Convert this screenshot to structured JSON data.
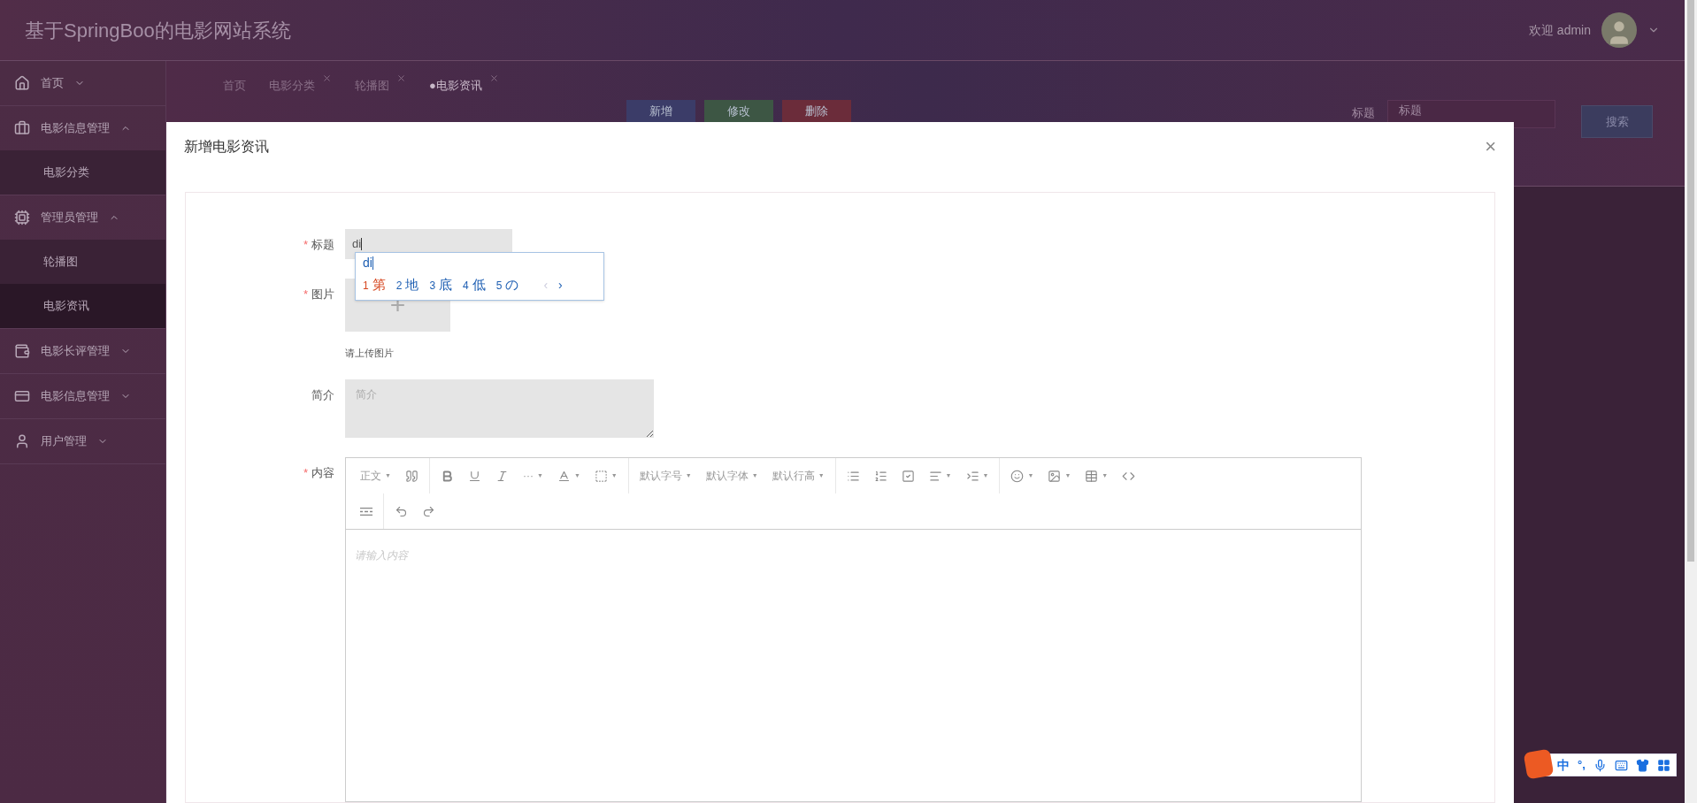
{
  "header": {
    "title": "基于SpringBoo的电影网站系统",
    "welcome": "欢迎 admin"
  },
  "sidebar": {
    "items": [
      {
        "label": "首页",
        "expanded": false,
        "selected": false
      },
      {
        "label": "电影信息管理",
        "expanded": true,
        "selected": false,
        "children": [
          {
            "label": "电影分类",
            "selected": false
          }
        ]
      },
      {
        "label": "管理员管理",
        "expanded": true,
        "selected": false,
        "children": [
          {
            "label": "轮播图",
            "selected": false
          },
          {
            "label": "电影资讯",
            "selected": true
          }
        ]
      },
      {
        "label": "电影长评管理",
        "expanded": false,
        "selected": false
      },
      {
        "label": "电影信息管理",
        "expanded": false,
        "selected": false
      },
      {
        "label": "用户管理",
        "expanded": false,
        "selected": false
      }
    ]
  },
  "tabs": [
    {
      "label": "首页",
      "selected": false,
      "closable": false
    },
    {
      "label": "电影分类",
      "selected": false,
      "closable": true
    },
    {
      "label": "轮播图",
      "selected": false,
      "closable": true
    },
    {
      "label": "●电影资讯",
      "selected": true,
      "closable": true
    }
  ],
  "actions": [
    {
      "label": "新增",
      "color": "#3b3c68"
    },
    {
      "label": "修改",
      "color": "#3d5644"
    },
    {
      "label": "删除",
      "color": "#6b2c3a"
    }
  ],
  "search": {
    "label": "标题",
    "placeholder": "标题",
    "button": "搜索"
  },
  "dialog": {
    "title": "新增电影资讯",
    "close": "×",
    "fields": [
      {
        "kind": "text",
        "label": "标题",
        "required_mark": "*",
        "value": "di",
        "ime": {
          "composition": "di",
          "candidates": [
            {
              "index": "1",
              "text": "第",
              "selected": true
            },
            {
              "index": "2",
              "text": "地",
              "selected": false
            },
            {
              "index": "3",
              "text": "底",
              "selected": false
            },
            {
              "index": "4",
              "text": "低",
              "selected": false
            },
            {
              "index": "5",
              "text": "の",
              "selected": false
            }
          ],
          "prev": "‹",
          "next": "›"
        }
      },
      {
        "kind": "upload",
        "label": "图片",
        "required_mark": "*",
        "plus": "+",
        "hint": "请上传图片"
      },
      {
        "kind": "textarea",
        "label": "简介",
        "placeholder": "简介"
      },
      {
        "kind": "editor",
        "label": "内容",
        "required_mark": "*",
        "placeholder": "请输入内容",
        "toolbar": [
          [
            {
              "kind": "text",
              "label": "正文",
              "caret": "▼"
            },
            {
              "kind": "icon"
            }
          ],
          [
            {
              "kind": "icon"
            },
            {
              "kind": "icon"
            },
            {
              "kind": "icon"
            },
            {
              "kind": "text",
              "label": "···",
              "caret": "▼"
            },
            {
              "kind": "icon",
              "caret": "▼"
            },
            {
              "kind": "icon",
              "caret": "▼"
            }
          ],
          [
            {
              "kind": "text",
              "label": "默认字号",
              "caret": "▼"
            },
            {
              "kind": "text",
              "label": "默认字体",
              "caret": "▼"
            },
            {
              "kind": "text",
              "label": "默认行高",
              "caret": "▼"
            }
          ],
          [
            {
              "kind": "icon"
            },
            {
              "kind": "icon"
            },
            {
              "kind": "icon"
            },
            {
              "kind": "icon",
              "caret": "▼"
            },
            {
              "kind": "icon",
              "caret": "▼"
            }
          ],
          [
            {
              "kind": "icon",
              "caret": "▼"
            },
            {
              "kind": "icon",
              "caret": "▼"
            },
            {
              "kind": "icon",
              "caret": "▼"
            },
            {
              "kind": "icon"
            }
          ],
          [
            {
              "kind": "icon"
            }
          ],
          [
            {
              "kind": "icon"
            },
            {
              "kind": "icon"
            }
          ]
        ]
      }
    ]
  },
  "ime_bar": {
    "mode": "中",
    "punct": "°,"
  }
}
